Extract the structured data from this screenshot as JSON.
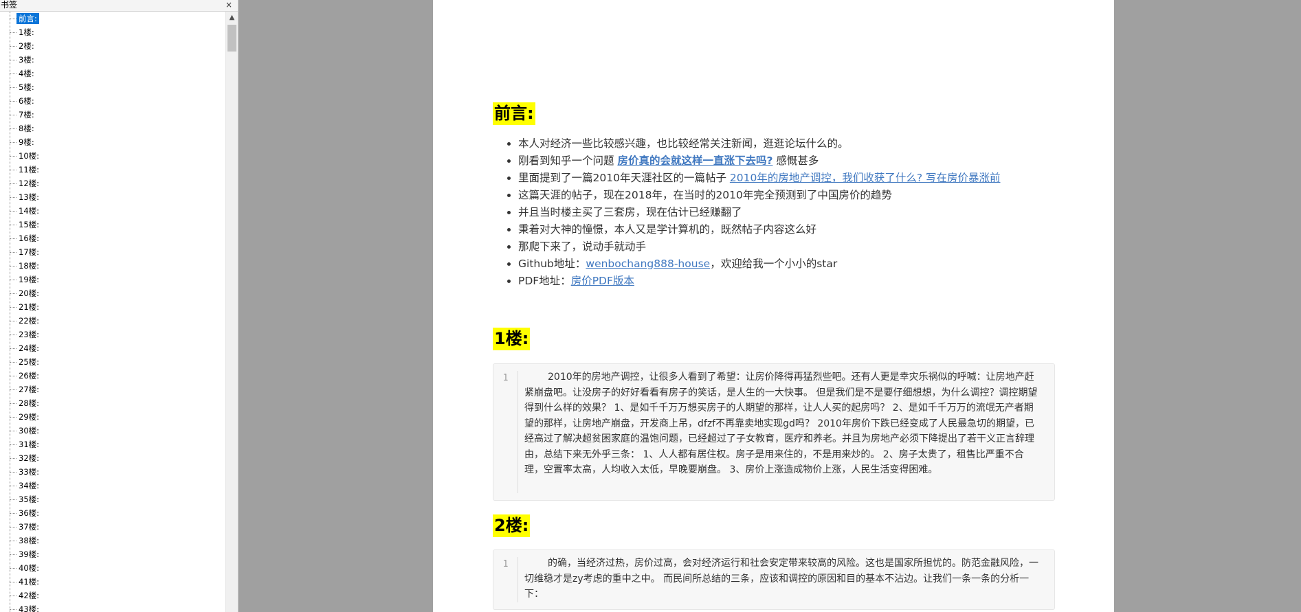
{
  "sidebar": {
    "title": "书签",
    "close_icon": "close-icon",
    "scroll_up_icon": "scroll-up-arrow-icon",
    "items": [
      {
        "label": "前言:",
        "active": true
      },
      {
        "label": "1楼:"
      },
      {
        "label": "2楼:"
      },
      {
        "label": "3楼:"
      },
      {
        "label": "4楼:"
      },
      {
        "label": "5楼:"
      },
      {
        "label": "6楼:"
      },
      {
        "label": "7楼:"
      },
      {
        "label": "8楼:"
      },
      {
        "label": "9楼:"
      },
      {
        "label": "10楼:"
      },
      {
        "label": "11楼:"
      },
      {
        "label": "12楼:"
      },
      {
        "label": "13楼:"
      },
      {
        "label": "14楼:"
      },
      {
        "label": "15楼:"
      },
      {
        "label": "16楼:"
      },
      {
        "label": "17楼:"
      },
      {
        "label": "18楼:"
      },
      {
        "label": "19楼:"
      },
      {
        "label": "20楼:"
      },
      {
        "label": "21楼:"
      },
      {
        "label": "22楼:"
      },
      {
        "label": "23楼:"
      },
      {
        "label": "24楼:"
      },
      {
        "label": "25楼:"
      },
      {
        "label": "26楼:"
      },
      {
        "label": "27楼:"
      },
      {
        "label": "28楼:"
      },
      {
        "label": "29楼:"
      },
      {
        "label": "30楼:"
      },
      {
        "label": "31楼:"
      },
      {
        "label": "32楼:"
      },
      {
        "label": "33楼:"
      },
      {
        "label": "34楼:"
      },
      {
        "label": "35楼:"
      },
      {
        "label": "36楼:"
      },
      {
        "label": "37楼:"
      },
      {
        "label": "38楼:"
      },
      {
        "label": "39楼:"
      },
      {
        "label": "40楼:"
      },
      {
        "label": "41楼:"
      },
      {
        "label": "42楼:"
      },
      {
        "label": "43楼:"
      }
    ]
  },
  "document": {
    "preface": {
      "heading": "前言:",
      "bullets": [
        {
          "text": "本人对经济一些比较感兴趣，也比较经常关注新闻，逛逛论坛什么的。"
        },
        {
          "text": "刚看到知乎一个问题 ",
          "link": "房价真的会就这样一直涨下去吗?",
          "link_bold": true,
          "after": " 感慨甚多"
        },
        {
          "text": "里面提到了一篇2010年天涯社区的一篇帖子 ",
          "link": "2010年的房地产调控，我们收获了什么? 写在房价暴涨前"
        },
        {
          "text": "这篇天涯的帖子，现在2018年，在当时的2010年完全预测到了中国房价的趋势"
        },
        {
          "text": "并且当时楼主买了三套房，现在估计已经赚翻了"
        },
        {
          "text": "秉着对大神的憧憬，本人又是学计算机的，既然帖子内容这么好"
        },
        {
          "text": "那爬下来了，说动手就动手"
        },
        {
          "text": "Github地址：",
          "link": "wenbochang888-house",
          "after": "，欢迎给我一个小小的star"
        },
        {
          "text": "PDF地址：",
          "link": "房价PDF版本"
        }
      ]
    },
    "floor1": {
      "heading": "1楼:",
      "line_number": "1",
      "text": "2010年的房地产调控，让很多人看到了希望：让房价降得再猛烈些吧。还有人更是幸灾乐祸似的呼喊：让房地产赶紧崩盘吧。让没房子的好好看看有房子的笑话，是人生的一大快事。  但是我们是不是要仔细想想，为什么调控？调控期望得到什么样的效果？  1、是如千千万万想买房子的人期望的那样，让人人买的起房吗？  2、是如千千万万的流氓无产者期望的那样，让房地产崩盘，开发商上吊，dfzf不再靠卖地实现gd吗？  2010年房价下跌已经变成了人民最急切的期望，已经高过了解决超贫困家庭的温饱问题，已经超过了子女教育，医疗和养老。并且为房地产必须下降提出了若干义正言辞理由，总结下来无外乎三条：  1、人人都有居住权。房子是用来住的，不是用来炒的。  2、房子太贵了，租售比严重不合理，空置率太高，人均收入太低，早晚要崩盘。  3、房价上涨造成物价上涨，人民生活变得困难。"
    },
    "floor2": {
      "heading": "2楼:",
      "line_number": "1",
      "text": "的确，当经济过热，房价过高，会对经济运行和社会安定带来较高的风险。这也是国家所担忧的。防范金融风险，一切维稳才是zy考虑的重中之中。  而民间所总结的三条，应该和调控的原因和目的基本不沾边。让我们一条一条的分析一下："
    }
  }
}
